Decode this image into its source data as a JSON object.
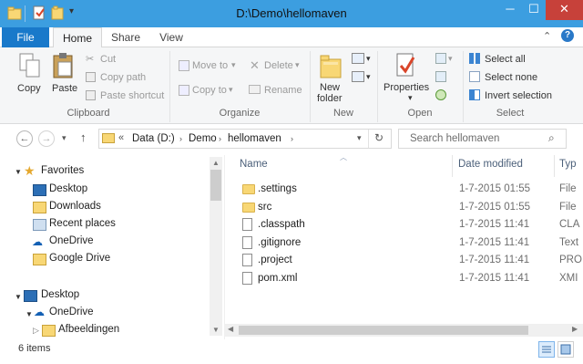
{
  "window": {
    "title": "D:\\Demo\\hellomaven"
  },
  "tabs": {
    "file": "File",
    "home": "Home",
    "share": "Share",
    "view": "View"
  },
  "ribbon": {
    "clipboard": {
      "copy": "Copy",
      "paste": "Paste",
      "cut": "Cut",
      "copy_path": "Copy path",
      "paste_shortcut": "Paste shortcut",
      "label": "Clipboard"
    },
    "organize": {
      "move_to": "Move to",
      "copy_to": "Copy to",
      "delete": "Delete",
      "rename": "Rename",
      "label": "Organize"
    },
    "new": {
      "new_folder_1": "New",
      "new_folder_2": "folder",
      "label": "New"
    },
    "open": {
      "properties": "Properties",
      "label": "Open"
    },
    "select": {
      "select_all": "Select all",
      "select_none": "Select none",
      "invert_selection": "Invert selection",
      "label": "Select"
    }
  },
  "address": {
    "overflow": "«",
    "crumbs": [
      "Data (D:)",
      "Demo",
      "hellomaven"
    ],
    "search_placeholder": "Search hellomaven"
  },
  "nav": {
    "favorites": "Favorites",
    "items": [
      "Desktop",
      "Downloads",
      "Recent places",
      "OneDrive",
      "Google Drive"
    ],
    "tree": [
      "Desktop",
      "OneDrive",
      "Afbeeldingen"
    ]
  },
  "columns": {
    "name": "Name",
    "date": "Date modified",
    "type": "Typ"
  },
  "files": [
    {
      "name": ".settings",
      "date": "1-7-2015 01:55",
      "type": "File",
      "icon": "folder-icon"
    },
    {
      "name": "src",
      "date": "1-7-2015 01:55",
      "type": "File",
      "icon": "folder-icon"
    },
    {
      "name": ".classpath",
      "date": "1-7-2015 11:41",
      "type": "CLA",
      "icon": "document-icon"
    },
    {
      "name": ".gitignore",
      "date": "1-7-2015 11:41",
      "type": "Text",
      "icon": "document-icon"
    },
    {
      "name": ".project",
      "date": "1-7-2015 11:41",
      "type": "PRO",
      "icon": "document-icon"
    },
    {
      "name": "pom.xml",
      "date": "1-7-2015 11:41",
      "type": "XMI",
      "icon": "document-icon"
    }
  ],
  "status": {
    "count": "6 items"
  }
}
